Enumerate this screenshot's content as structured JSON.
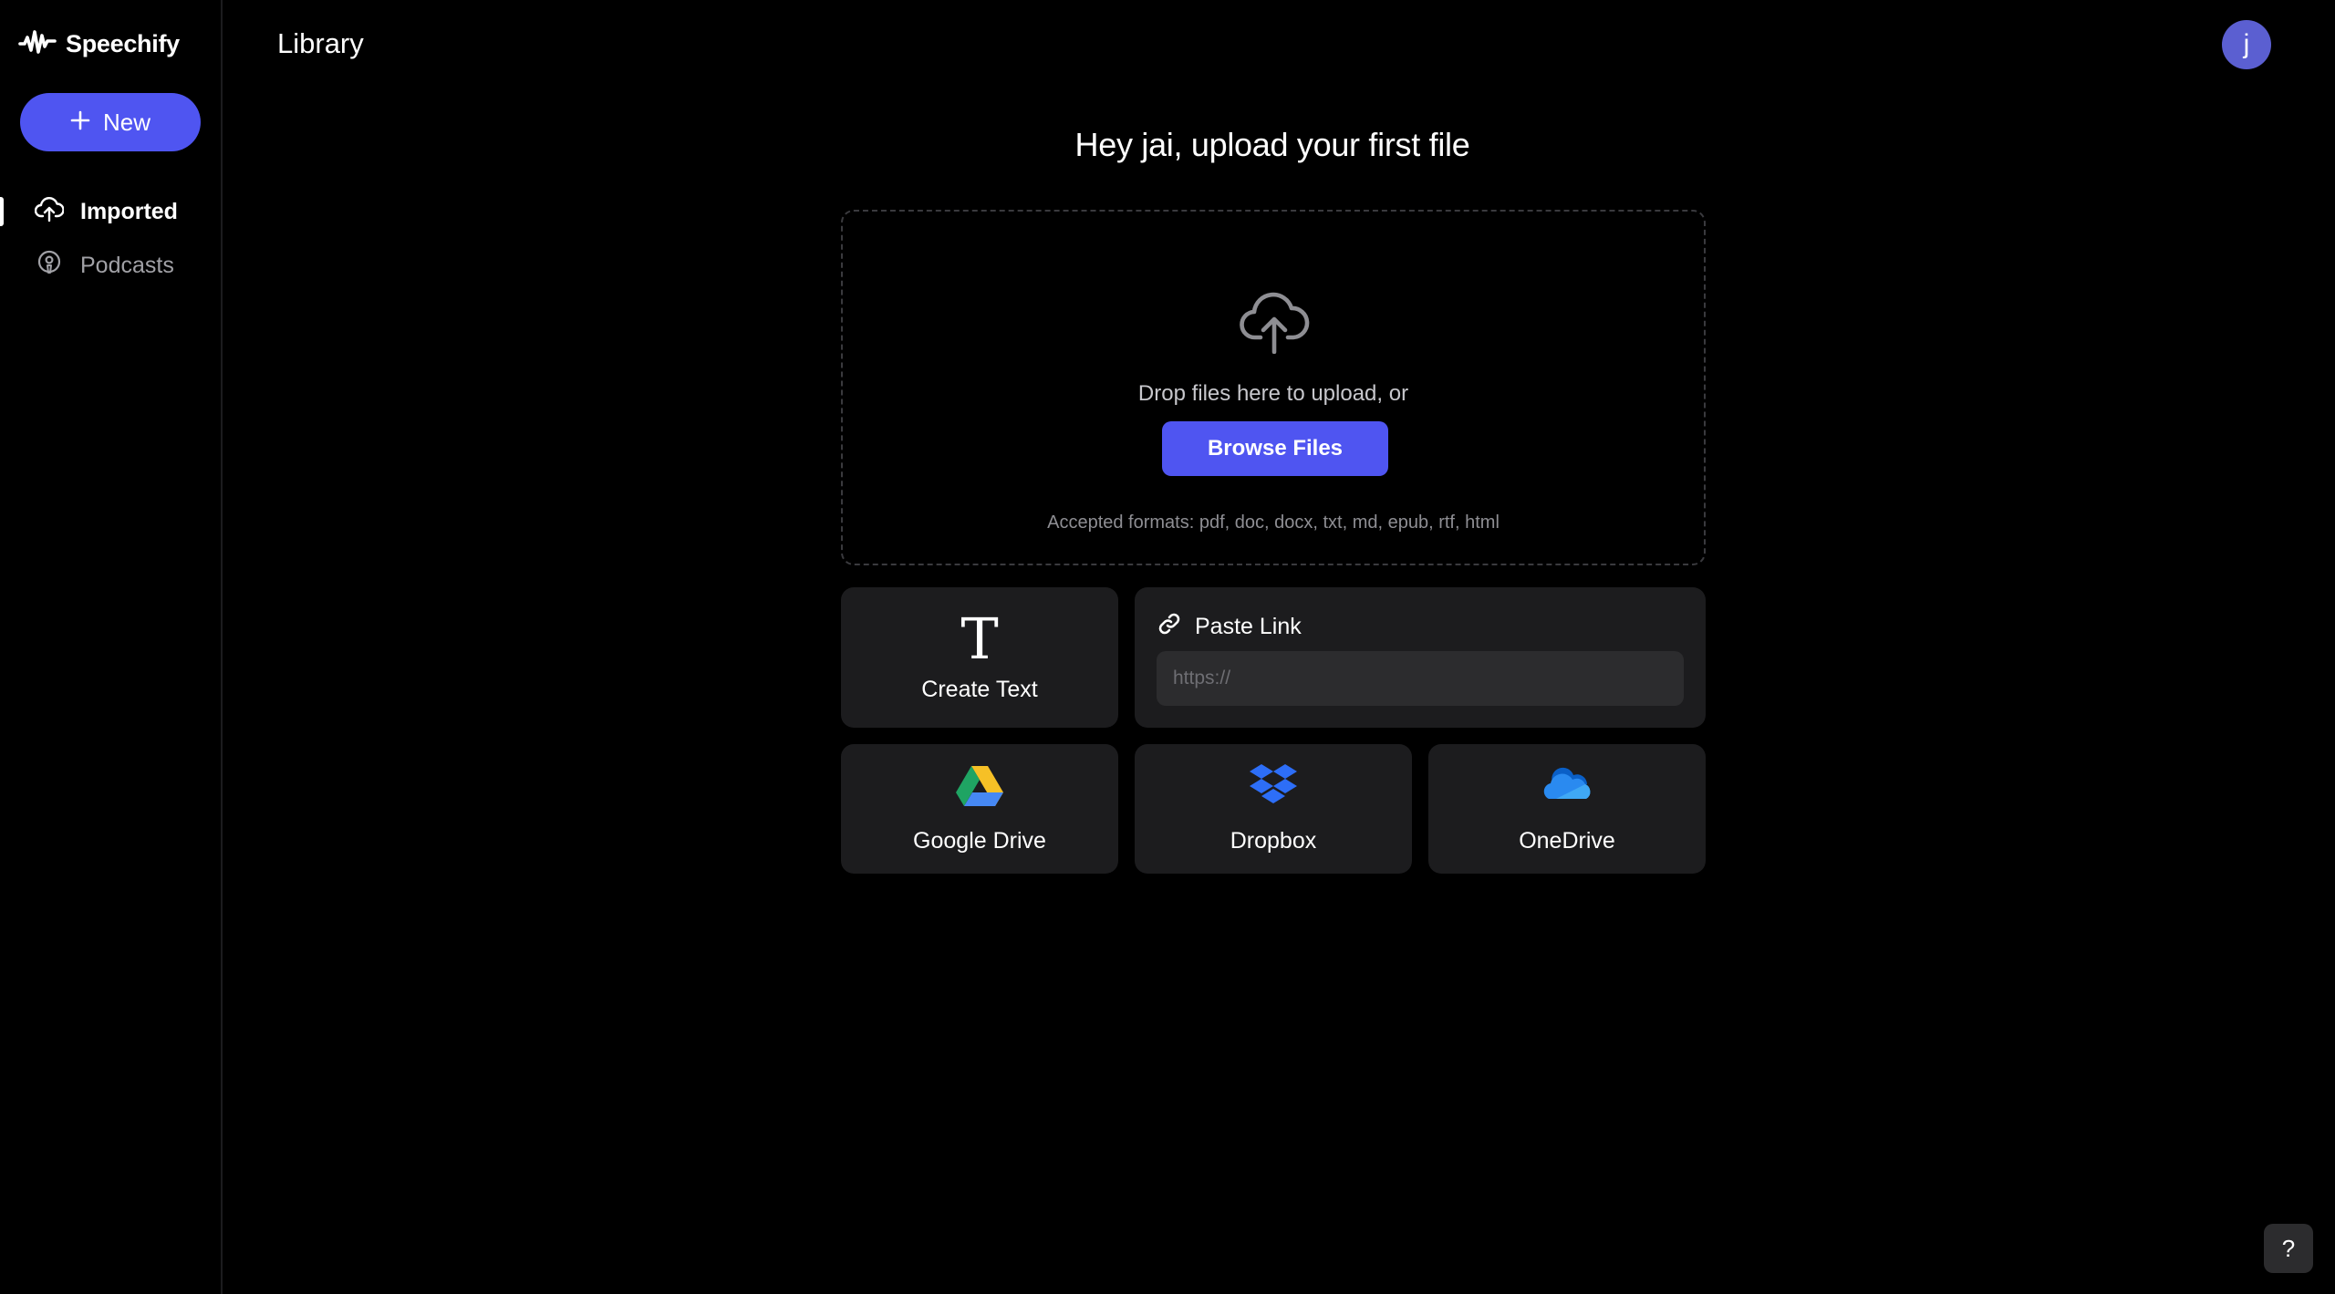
{
  "sidebar": {
    "brand": {
      "name": "Speechify",
      "icon": "waveform-logo-icon"
    },
    "new_button": {
      "label": "New",
      "icon": "plus-icon"
    },
    "items": [
      {
        "label": "Imported",
        "icon": "cloud-upload-icon",
        "active": true
      },
      {
        "label": "Podcasts",
        "icon": "podcast-icon",
        "active": false
      }
    ]
  },
  "header": {
    "title": "Library",
    "avatar_initial": "j",
    "avatar_color": "#5b5fd1"
  },
  "main": {
    "greeting": "Hey jai, upload your first file",
    "dropzone": {
      "icon": "cloud-upload-icon",
      "text": "Drop files here to upload, or",
      "browse_label": "Browse Files",
      "formats": "Accepted formats: pdf, doc, docx, txt, md, epub, rtf, html"
    },
    "create_text": {
      "label": "Create Text",
      "icon_glyph": "T"
    },
    "paste_link": {
      "label": "Paste Link",
      "icon": "link-icon",
      "placeholder": "https://",
      "value": ""
    },
    "services": [
      {
        "label": "Google Drive",
        "icon": "google-drive-icon"
      },
      {
        "label": "Dropbox",
        "icon": "dropbox-icon"
      },
      {
        "label": "OneDrive",
        "icon": "onedrive-icon"
      }
    ]
  },
  "help_button": {
    "label": "?"
  },
  "colors": {
    "accent": "#4f55f1",
    "background": "#000000",
    "card": "#1c1c1e",
    "input": "#2c2c2e"
  }
}
